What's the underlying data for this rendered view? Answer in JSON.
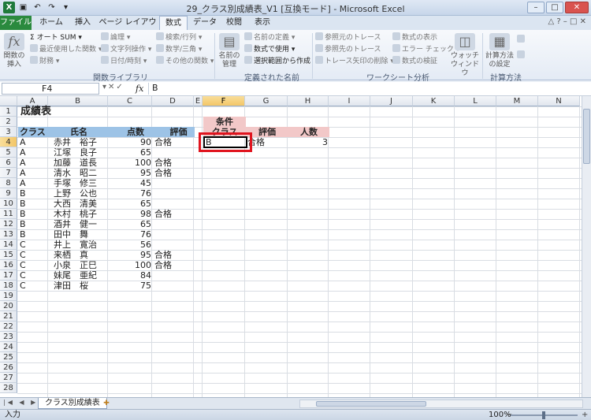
{
  "window": {
    "title": "29_クラス別成績表_V1  [互換モード]  -  Microsoft Excel",
    "controls": [
      "–",
      "□",
      "✕"
    ]
  },
  "ribbon_tabs": [
    "ファイル",
    "ホーム",
    "挿入",
    "ページ レイアウト",
    "数式",
    "データ",
    "校閲",
    "表示"
  ],
  "ribbon": {
    "insert_function": "関数の\n挿入",
    "autosum": "オート SUM",
    "recent": "最近使用した関数",
    "financial": "財務",
    "logical": "論理",
    "text": "文字列操作",
    "datetime": "日付/時刻",
    "lookup": "検索/行列",
    "math": "数学/三角",
    "more": "その他の関数",
    "group_library": "関数ライブラリ",
    "name_manager": "名前の\n管理",
    "define_name": "名前の定義",
    "use_in_formula": "数式で使用",
    "create_from_selection": "選択範囲から作成",
    "group_names": "定義された名前",
    "trace_precedents": "参照元のトレース",
    "trace_dependents": "参照先のトレース",
    "remove_arrows": "トレース矢印の削除",
    "show_formulas": "数式の表示",
    "error_checking": "エラー チェック",
    "evaluate": "数式の検証",
    "watch": "ウォッチ\nウィンドウ",
    "group_audit": "ワークシート分析",
    "calc_options": "計算方法\nの設定",
    "group_calc": "計算方法"
  },
  "formula_bar": {
    "name_box": "F4",
    "fx": "fx",
    "content": "B"
  },
  "columns": [
    "A",
    "B",
    "C",
    "D",
    "E",
    "F",
    "G",
    "H",
    "I",
    "J",
    "K",
    "L",
    "M",
    "N"
  ],
  "rows": [
    "1",
    "2",
    "3",
    "4",
    "5",
    "6",
    "7",
    "8",
    "9",
    "10",
    "11",
    "12",
    "13",
    "14",
    "15",
    "16",
    "17",
    "18",
    "19",
    "20",
    "21",
    "22",
    "23",
    "24",
    "25",
    "26",
    "27",
    "28"
  ],
  "sheet": {
    "title": "成績表",
    "headers": {
      "class": "クラス",
      "name": "氏名",
      "score": "点数",
      "grade": "評価"
    },
    "records": [
      {
        "class": "A",
        "name": "赤井　裕子",
        "score": "90",
        "grade": "合格"
      },
      {
        "class": "A",
        "name": "江塚　良子",
        "score": "65",
        "grade": ""
      },
      {
        "class": "A",
        "name": "加藤　道長",
        "score": "100",
        "grade": "合格"
      },
      {
        "class": "A",
        "name": "清水　昭二",
        "score": "95",
        "grade": "合格"
      },
      {
        "class": "A",
        "name": "手塚　修三",
        "score": "45",
        "grade": ""
      },
      {
        "class": "B",
        "name": "上野　公也",
        "score": "76",
        "grade": ""
      },
      {
        "class": "B",
        "name": "大西　清美",
        "score": "65",
        "grade": ""
      },
      {
        "class": "B",
        "name": "木村　桃子",
        "score": "98",
        "grade": "合格"
      },
      {
        "class": "B",
        "name": "酒井　健一",
        "score": "65",
        "grade": ""
      },
      {
        "class": "B",
        "name": "田中　舞",
        "score": "76",
        "grade": ""
      },
      {
        "class": "C",
        "name": "井上　寛治",
        "score": "56",
        "grade": ""
      },
      {
        "class": "C",
        "name": "来栖　真",
        "score": "95",
        "grade": "合格"
      },
      {
        "class": "C",
        "name": "小泉　正巳",
        "score": "100",
        "grade": "合格"
      },
      {
        "class": "C",
        "name": "妹尾　亜紀",
        "score": "84",
        "grade": ""
      },
      {
        "class": "C",
        "name": "津田　桜",
        "score": "75",
        "grade": ""
      }
    ],
    "criteria": {
      "label": "条件",
      "class_header": "クラス",
      "grade_header": "評価",
      "count_header": "人数",
      "class_value": "B",
      "grade_value": "合格",
      "count_value": "3"
    }
  },
  "sheet_tab": "クラス別成績表",
  "status": {
    "mode": "入力",
    "zoom": "100%"
  },
  "colors": {
    "header_blue": "#9dc3e6",
    "header_pink": "#f2c8c8",
    "highlight_red": "#e0141e",
    "file_tab_green": "#2a8a3e"
  }
}
